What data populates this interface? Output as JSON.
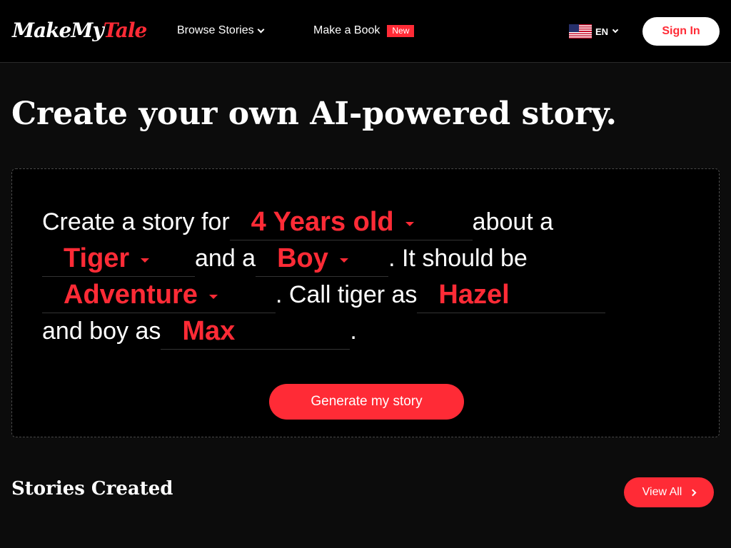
{
  "header": {
    "logo_part1": "MakeMy",
    "logo_part2": "Tale",
    "browse_label": "Browse Stories",
    "make_book_label": "Make a Book",
    "new_badge": "New",
    "language": "EN",
    "signin_label": "Sign In"
  },
  "hero": {
    "title": "Create your own AI-powered story."
  },
  "story_form": {
    "text_1": "Create a story for",
    "age_value": "4 Years old",
    "text_2": "about a",
    "animal_value": "Tiger",
    "text_3": "and a",
    "gender_value": "Boy",
    "text_4": ". It should be",
    "genre_value": "Adventure",
    "text_5": ". Call tiger as",
    "animal_name_value": "Hazel",
    "text_6": "and boy as",
    "child_name_value": "Max",
    "text_7": ".",
    "generate_label": "Generate my story"
  },
  "stories": {
    "title": "Stories Created",
    "view_all_label": "View All"
  },
  "colors": {
    "accent": "#ff2b36",
    "background": "#0c0c0c",
    "header_bg": "#000000"
  }
}
